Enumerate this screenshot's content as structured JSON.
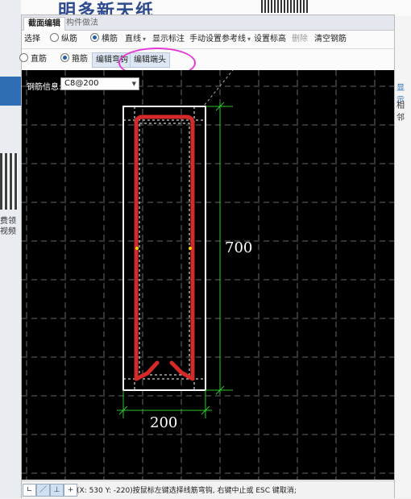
{
  "tabs": [
    "截面编辑",
    "构件做法"
  ],
  "toolbar1": {
    "select": "选择",
    "longitudinal": "纵筋",
    "transverse": "横筋",
    "line": "直线",
    "show_dim": "显示标注",
    "manual_ref": "手动设置参考线",
    "set_elev": "设置标高",
    "delete": "删除",
    "clear": "清空钢筋"
  },
  "toolbar2": {
    "straight": "直筋",
    "stirrup": "箍筋",
    "edit_hook": "编辑弯钩",
    "edit_end": "编辑端头"
  },
  "rebar_info": {
    "label": "钢筋信息:",
    "value": "C8@200"
  },
  "dimensions": {
    "height": "700",
    "width": "200"
  },
  "status": {
    "text": "(X: 530 Y: -220)按鼠标左键选择线筋弯钩, 右键中止或 ESC 键取消;"
  },
  "background": {
    "left_text_1": "费领",
    "left_text_2": "视频",
    "right_label_1": "显示",
    "right_label_2": "相邻",
    "logo_fragment": "明多新天纸"
  },
  "colors": {
    "accent": "#1f5fa8",
    "rebar": "#d42a2a",
    "dimension": "#2ec52e",
    "highlight": "#e43ad4"
  }
}
